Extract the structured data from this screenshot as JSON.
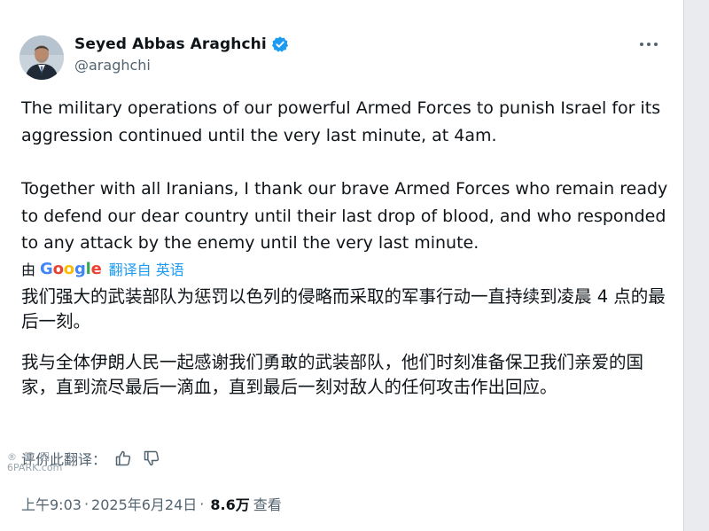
{
  "author": {
    "name": "Seyed Abbas Araghchi",
    "handle": "@araghchi"
  },
  "tweet": {
    "text_p1": "The military operations of our powerful Armed Forces to punish Israel for its aggression continued until the very last minute, at 4am.",
    "text_p2": "Together with all Iranians, I thank our brave Armed Forces who remain ready to defend our dear country until their last drop of blood, and who responded to any attack by the enemy until the very last minute."
  },
  "translation": {
    "by_label": "由",
    "logo_letters": [
      "G",
      "o",
      "o",
      "g",
      "l",
      "e"
    ],
    "logo_colors": [
      "#4285F4",
      "#EA4335",
      "#FBBC05",
      "#4285F4",
      "#34A853",
      "#EA4335"
    ],
    "link_label": "翻译自 英语",
    "p1": "我们强大的武装部队为惩罚以色列的侵略而采取的军事行动一直持续到凌晨 4 点的最后一刻。",
    "p2": "我与全体伊朗人民一起感谢我们勇敢的武装部队，他们时刻准备保卫我们亲爱的国家，直到流尽最后一滴血，直到最后一刻对敌人的任何攻击作出回应。",
    "rate_label": "评价此翻译："
  },
  "watermark": {
    "line1": "® 留 园",
    "line2": "6PARK.com"
  },
  "meta": {
    "time": "上午9:03",
    "separator": "·",
    "date": "2025年6月24日",
    "views": "8.6万",
    "views_label": "查看"
  },
  "colors": {
    "verified_blue": "#1d9bf0",
    "text_primary": "#0f1419",
    "text_secondary": "#536471"
  }
}
